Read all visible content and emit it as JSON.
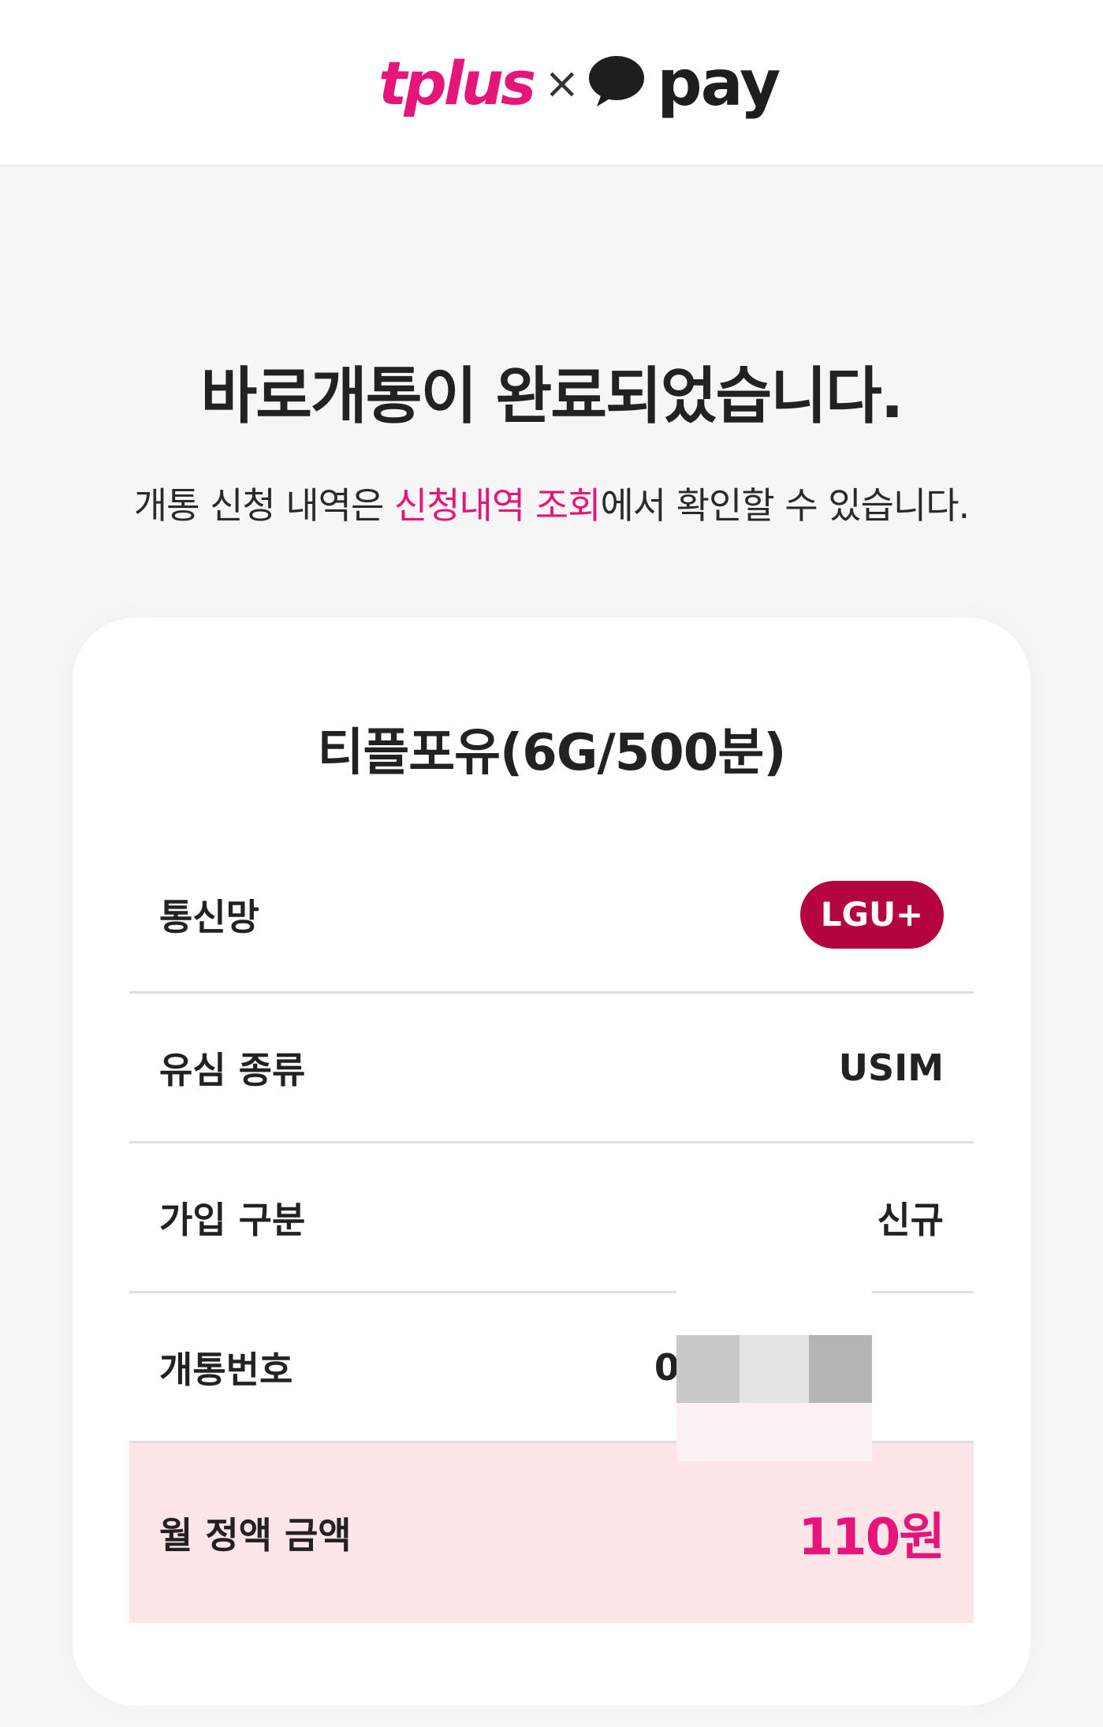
{
  "header": {
    "logo_left": "tplus",
    "logo_separator": "×",
    "logo_right": "pay"
  },
  "headline": "바로개통이 완료되었습니다.",
  "subline": {
    "before": "개통 신청 내역은 ",
    "link": "신청내역 조회",
    "after": "에서 확인할 수 있습니다."
  },
  "card": {
    "plan_name": "티플포유(6G/500분)",
    "network_label": "통신망",
    "network_value": "LGU+",
    "sim_label": "유심 종류",
    "sim_value": "USIM",
    "join_label": "가입 구분",
    "join_value": "신규",
    "number_label": "개통번호",
    "number_value": "010-",
    "total_label": "월 정액 금액",
    "total_value": "110원"
  },
  "colors": {
    "brand_pink": "#e6157a",
    "lgu_badge": "#b4053f",
    "total_bg": "#fde5e8"
  }
}
